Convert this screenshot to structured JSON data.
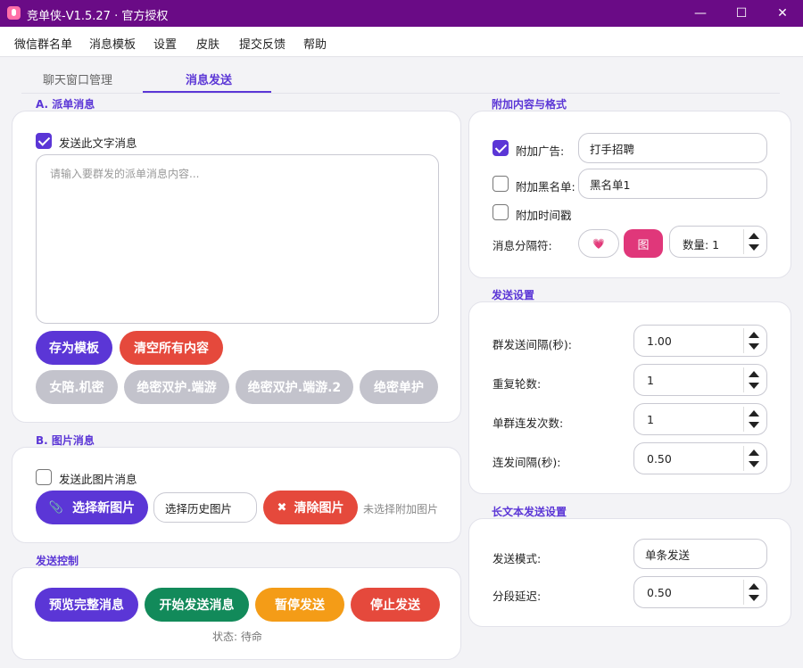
{
  "window": {
    "title": "竞单侠-V1.5.27 · 官方授权",
    "minimize_glyph": "—",
    "maximize_glyph": "☐",
    "close_glyph": "✕"
  },
  "menu": [
    "微信群名单",
    "消息模板",
    "设置",
    "皮肤",
    "提交反馈",
    "帮助"
  ],
  "tabs": [
    {
      "label": "聊天窗口管理"
    },
    {
      "label": "消息发送"
    }
  ],
  "dispatch": {
    "section_title": "A. 派单消息",
    "send_text_label": "发送此文字消息",
    "textarea_placeholder": "请输入要群发的派单消息内容...",
    "save_template": "存为模板",
    "clear_all": "清空所有内容",
    "templates": [
      "女陪.机密",
      "绝密双护.端游",
      "绝密双护.端游.2",
      "绝密单护"
    ]
  },
  "image": {
    "section_title": "B. 图片消息",
    "send_image_label": "发送此图片消息",
    "select_new": "选择新图片",
    "history_placeholder": "选择历史图片",
    "clear_image": "清除图片",
    "no_image": "未选择附加图片"
  },
  "control": {
    "section_title": "发送控制",
    "preview": "预览完整消息",
    "start": "开始发送消息",
    "pause": "暂停发送",
    "stop": "停止发送",
    "status": "状态: 待命"
  },
  "extra": {
    "section_title": "附加内容与格式",
    "ad_label": "附加广告:",
    "ad_value": "打手招聘",
    "blacklist_label": "附加黑名单:",
    "blacklist_value": "黑名单1",
    "timestamp_label": "附加时间戳",
    "separator_label": "消息分隔符:",
    "separator_emoji": "💗",
    "separator_image": "图",
    "count_value": "数量: 1"
  },
  "send_settings": {
    "section_title": "发送设置",
    "rows": [
      {
        "label": "群发送间隔(秒):",
        "value": "1.00"
      },
      {
        "label": "重复轮数:",
        "value": "1"
      },
      {
        "label": "单群连发次数:",
        "value": "1"
      },
      {
        "label": "连发间隔(秒):",
        "value": "0.50"
      }
    ]
  },
  "long_text": {
    "section_title": "长文本发送设置",
    "mode_label": "发送模式:",
    "mode_value": "单条发送",
    "delay_label": "分段延迟:",
    "delay_value": "0.50"
  }
}
